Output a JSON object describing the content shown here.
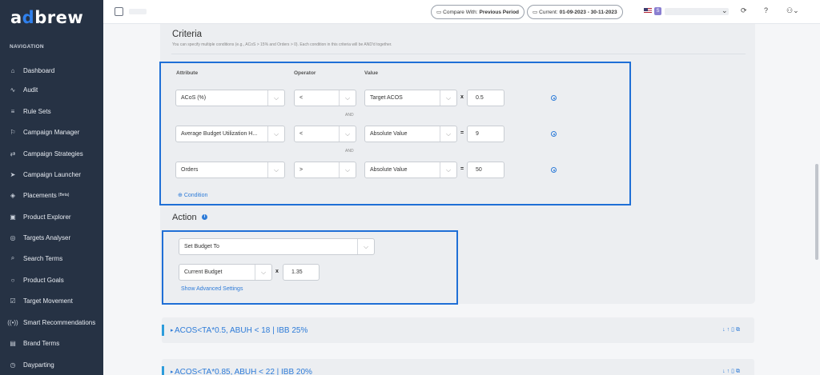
{
  "app": {
    "logo_a": "a",
    "logo_d": "d",
    "logo_rest": "brew"
  },
  "sidebar": {
    "heading": "NAVIGATION",
    "items": [
      {
        "label": "Dashboard",
        "icon": "home-icon",
        "glyph": "⌂"
      },
      {
        "label": "Audit",
        "icon": "pulse-icon",
        "glyph": "∿"
      },
      {
        "label": "Rule Sets",
        "icon": "list-icon",
        "glyph": "≡"
      },
      {
        "label": "Campaign Manager",
        "icon": "flag-icon",
        "glyph": "⚐"
      },
      {
        "label": "Campaign Strategies",
        "icon": "repeat-icon",
        "glyph": "⇄"
      },
      {
        "label": "Campaign Launcher",
        "icon": "send-icon",
        "glyph": "➤"
      },
      {
        "label": "Placements",
        "sup": "(Beta)",
        "icon": "layers-icon",
        "glyph": "◈"
      },
      {
        "label": "Product Explorer",
        "icon": "box-icon",
        "glyph": "▣"
      },
      {
        "label": "Targets Analyser",
        "icon": "target-icon",
        "glyph": "◎"
      },
      {
        "label": "Search Terms",
        "icon": "search-icon",
        "glyph": "⌕"
      },
      {
        "label": "Product Goals",
        "icon": "circle-icon",
        "glyph": "○"
      },
      {
        "label": "Target Movement",
        "icon": "checkbox-icon",
        "glyph": "☑"
      },
      {
        "label": "Smart Recommendations",
        "icon": "broadcast-icon",
        "glyph": "((•))"
      },
      {
        "label": "Brand Terms",
        "icon": "clipboard-icon",
        "glyph": "▤"
      },
      {
        "label": "Dayparting",
        "icon": "clock-icon",
        "glyph": "◷"
      }
    ]
  },
  "topbar": {
    "compare_prefix": "Compare With:",
    "compare_value": "Previous Period",
    "current_prefix": "Current:",
    "current_value": "01-09-2023 - 30-11-2023",
    "account_badge": "S"
  },
  "criteria": {
    "title": "Criteria",
    "subtitle": "You can specify multiple conditions (e.g., ACoS > 15% and Orders > 0). Each condition in this criteria will be AND'd together.",
    "col_attribute": "Attribute",
    "col_operator": "Operator",
    "col_value": "Value",
    "and_label": "AND",
    "add_condition": "Condition",
    "conditions": [
      {
        "attribute": "ACoS (%)",
        "operator": "<",
        "value_type": "Target ACOS",
        "op_symbol": "x",
        "value": "0.5"
      },
      {
        "attribute": "Average Budget Utilization H...",
        "operator": "<",
        "value_type": "Absolute Value",
        "op_symbol": "=",
        "value": "9"
      },
      {
        "attribute": "Orders",
        "operator": ">",
        "value_type": "Absolute Value",
        "op_symbol": "=",
        "value": "50"
      }
    ]
  },
  "action": {
    "title": "Action",
    "info_glyph": "i",
    "type": "Set Budget To",
    "base": "Current Budget",
    "op_symbol": "x",
    "value": "1.35",
    "advanced_link": "Show Advanced Settings"
  },
  "rules": [
    {
      "title": "ACOS<TA*0.5, ABUH < 18 | IBB 25%"
    },
    {
      "title": "ACOS<TA*0.85, ABUH < 22 | IBB 20%"
    }
  ],
  "glyphs": {
    "chevron": "⌵",
    "triangle": "▸",
    "rule_actions": "↓↑🗑⧉",
    "refresh": "⟳",
    "help": "?",
    "user": "⚇",
    "caret": "⌄",
    "calendar": "▭"
  }
}
